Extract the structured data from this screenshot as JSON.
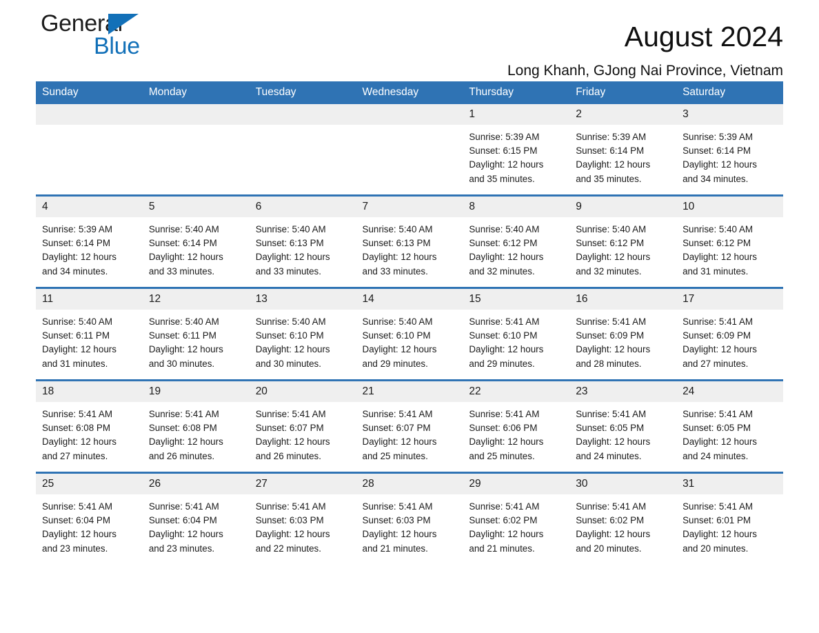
{
  "brand": {
    "name_part1": "General",
    "name_part2": "Blue",
    "triangle_icon": "brand-triangle-icon",
    "accent_color": "#1270b8"
  },
  "header": {
    "title": "August 2024",
    "subtitle": "Long Khanh, GJong Nai Province, Vietnam"
  },
  "theme": {
    "header_blue": "#2f73b4",
    "daynum_gray": "#efefef",
    "text": "#1a1a1a"
  },
  "weekday_headers": [
    "Sunday",
    "Monday",
    "Tuesday",
    "Wednesday",
    "Thursday",
    "Friday",
    "Saturday"
  ],
  "weeks": [
    [
      {
        "day": "",
        "sunrise": "",
        "sunset": "",
        "daylight1": "",
        "daylight2": ""
      },
      {
        "day": "",
        "sunrise": "",
        "sunset": "",
        "daylight1": "",
        "daylight2": ""
      },
      {
        "day": "",
        "sunrise": "",
        "sunset": "",
        "daylight1": "",
        "daylight2": ""
      },
      {
        "day": "",
        "sunrise": "",
        "sunset": "",
        "daylight1": "",
        "daylight2": ""
      },
      {
        "day": "1",
        "sunrise": "Sunrise: 5:39 AM",
        "sunset": "Sunset: 6:15 PM",
        "daylight1": "Daylight: 12 hours",
        "daylight2": "and 35 minutes."
      },
      {
        "day": "2",
        "sunrise": "Sunrise: 5:39 AM",
        "sunset": "Sunset: 6:14 PM",
        "daylight1": "Daylight: 12 hours",
        "daylight2": "and 35 minutes."
      },
      {
        "day": "3",
        "sunrise": "Sunrise: 5:39 AM",
        "sunset": "Sunset: 6:14 PM",
        "daylight1": "Daylight: 12 hours",
        "daylight2": "and 34 minutes."
      }
    ],
    [
      {
        "day": "4",
        "sunrise": "Sunrise: 5:39 AM",
        "sunset": "Sunset: 6:14 PM",
        "daylight1": "Daylight: 12 hours",
        "daylight2": "and 34 minutes."
      },
      {
        "day": "5",
        "sunrise": "Sunrise: 5:40 AM",
        "sunset": "Sunset: 6:14 PM",
        "daylight1": "Daylight: 12 hours",
        "daylight2": "and 33 minutes."
      },
      {
        "day": "6",
        "sunrise": "Sunrise: 5:40 AM",
        "sunset": "Sunset: 6:13 PM",
        "daylight1": "Daylight: 12 hours",
        "daylight2": "and 33 minutes."
      },
      {
        "day": "7",
        "sunrise": "Sunrise: 5:40 AM",
        "sunset": "Sunset: 6:13 PM",
        "daylight1": "Daylight: 12 hours",
        "daylight2": "and 33 minutes."
      },
      {
        "day": "8",
        "sunrise": "Sunrise: 5:40 AM",
        "sunset": "Sunset: 6:12 PM",
        "daylight1": "Daylight: 12 hours",
        "daylight2": "and 32 minutes."
      },
      {
        "day": "9",
        "sunrise": "Sunrise: 5:40 AM",
        "sunset": "Sunset: 6:12 PM",
        "daylight1": "Daylight: 12 hours",
        "daylight2": "and 32 minutes."
      },
      {
        "day": "10",
        "sunrise": "Sunrise: 5:40 AM",
        "sunset": "Sunset: 6:12 PM",
        "daylight1": "Daylight: 12 hours",
        "daylight2": "and 31 minutes."
      }
    ],
    [
      {
        "day": "11",
        "sunrise": "Sunrise: 5:40 AM",
        "sunset": "Sunset: 6:11 PM",
        "daylight1": "Daylight: 12 hours",
        "daylight2": "and 31 minutes."
      },
      {
        "day": "12",
        "sunrise": "Sunrise: 5:40 AM",
        "sunset": "Sunset: 6:11 PM",
        "daylight1": "Daylight: 12 hours",
        "daylight2": "and 30 minutes."
      },
      {
        "day": "13",
        "sunrise": "Sunrise: 5:40 AM",
        "sunset": "Sunset: 6:10 PM",
        "daylight1": "Daylight: 12 hours",
        "daylight2": "and 30 minutes."
      },
      {
        "day": "14",
        "sunrise": "Sunrise: 5:40 AM",
        "sunset": "Sunset: 6:10 PM",
        "daylight1": "Daylight: 12 hours",
        "daylight2": "and 29 minutes."
      },
      {
        "day": "15",
        "sunrise": "Sunrise: 5:41 AM",
        "sunset": "Sunset: 6:10 PM",
        "daylight1": "Daylight: 12 hours",
        "daylight2": "and 29 minutes."
      },
      {
        "day": "16",
        "sunrise": "Sunrise: 5:41 AM",
        "sunset": "Sunset: 6:09 PM",
        "daylight1": "Daylight: 12 hours",
        "daylight2": "and 28 minutes."
      },
      {
        "day": "17",
        "sunrise": "Sunrise: 5:41 AM",
        "sunset": "Sunset: 6:09 PM",
        "daylight1": "Daylight: 12 hours",
        "daylight2": "and 27 minutes."
      }
    ],
    [
      {
        "day": "18",
        "sunrise": "Sunrise: 5:41 AM",
        "sunset": "Sunset: 6:08 PM",
        "daylight1": "Daylight: 12 hours",
        "daylight2": "and 27 minutes."
      },
      {
        "day": "19",
        "sunrise": "Sunrise: 5:41 AM",
        "sunset": "Sunset: 6:08 PM",
        "daylight1": "Daylight: 12 hours",
        "daylight2": "and 26 minutes."
      },
      {
        "day": "20",
        "sunrise": "Sunrise: 5:41 AM",
        "sunset": "Sunset: 6:07 PM",
        "daylight1": "Daylight: 12 hours",
        "daylight2": "and 26 minutes."
      },
      {
        "day": "21",
        "sunrise": "Sunrise: 5:41 AM",
        "sunset": "Sunset: 6:07 PM",
        "daylight1": "Daylight: 12 hours",
        "daylight2": "and 25 minutes."
      },
      {
        "day": "22",
        "sunrise": "Sunrise: 5:41 AM",
        "sunset": "Sunset: 6:06 PM",
        "daylight1": "Daylight: 12 hours",
        "daylight2": "and 25 minutes."
      },
      {
        "day": "23",
        "sunrise": "Sunrise: 5:41 AM",
        "sunset": "Sunset: 6:05 PM",
        "daylight1": "Daylight: 12 hours",
        "daylight2": "and 24 minutes."
      },
      {
        "day": "24",
        "sunrise": "Sunrise: 5:41 AM",
        "sunset": "Sunset: 6:05 PM",
        "daylight1": "Daylight: 12 hours",
        "daylight2": "and 24 minutes."
      }
    ],
    [
      {
        "day": "25",
        "sunrise": "Sunrise: 5:41 AM",
        "sunset": "Sunset: 6:04 PM",
        "daylight1": "Daylight: 12 hours",
        "daylight2": "and 23 minutes."
      },
      {
        "day": "26",
        "sunrise": "Sunrise: 5:41 AM",
        "sunset": "Sunset: 6:04 PM",
        "daylight1": "Daylight: 12 hours",
        "daylight2": "and 23 minutes."
      },
      {
        "day": "27",
        "sunrise": "Sunrise: 5:41 AM",
        "sunset": "Sunset: 6:03 PM",
        "daylight1": "Daylight: 12 hours",
        "daylight2": "and 22 minutes."
      },
      {
        "day": "28",
        "sunrise": "Sunrise: 5:41 AM",
        "sunset": "Sunset: 6:03 PM",
        "daylight1": "Daylight: 12 hours",
        "daylight2": "and 21 minutes."
      },
      {
        "day": "29",
        "sunrise": "Sunrise: 5:41 AM",
        "sunset": "Sunset: 6:02 PM",
        "daylight1": "Daylight: 12 hours",
        "daylight2": "and 21 minutes."
      },
      {
        "day": "30",
        "sunrise": "Sunrise: 5:41 AM",
        "sunset": "Sunset: 6:02 PM",
        "daylight1": "Daylight: 12 hours",
        "daylight2": "and 20 minutes."
      },
      {
        "day": "31",
        "sunrise": "Sunrise: 5:41 AM",
        "sunset": "Sunset: 6:01 PM",
        "daylight1": "Daylight: 12 hours",
        "daylight2": "and 20 minutes."
      }
    ]
  ]
}
